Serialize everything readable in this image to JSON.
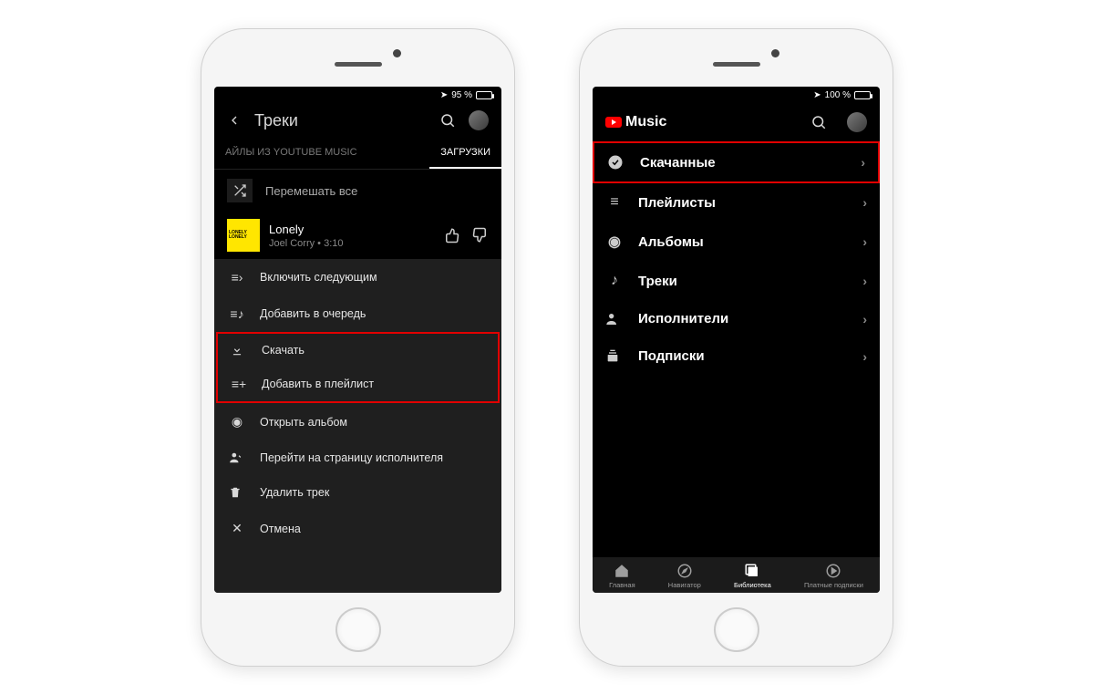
{
  "left": {
    "status": {
      "battery_text": "95 %",
      "battery_fill": 95
    },
    "header": {
      "title": "Треки",
      "back_icon": "back-icon",
      "search_icon": "search-icon",
      "avatar_icon": "avatar"
    },
    "tabs": {
      "tab1": "АЙЛЫ ИЗ YOUTUBE MUSIC",
      "tab2": "ЗАГРУЗКИ"
    },
    "shuffle_label": "Перемешать все",
    "track": {
      "name": "Lonely",
      "artist_line": "Joel Corry • 3:10",
      "art_text_1": "LONELY",
      "art_text_2": "LONELY"
    },
    "sheet": {
      "play_next": "Включить следующим",
      "add_queue": "Добавить в очередь",
      "download": "Скачать",
      "add_playlist": "Добавить в плейлист",
      "open_album": "Открыть альбом",
      "go_artist": "Перейти на страницу исполнителя",
      "delete": "Удалить трек",
      "cancel": "Отмена"
    }
  },
  "right": {
    "status": {
      "battery_text": "100 %",
      "battery_fill": 100
    },
    "logo_text": "Music",
    "library": {
      "downloaded": "Скачанные",
      "playlists": "Плейлисты",
      "albums": "Альбомы",
      "tracks": "Треки",
      "artists": "Исполнители",
      "subs": "Подписки"
    },
    "nav": {
      "home": "Главная",
      "explore": "Навигатор",
      "library": "Библиотека",
      "paid": "Платные подписки"
    }
  }
}
